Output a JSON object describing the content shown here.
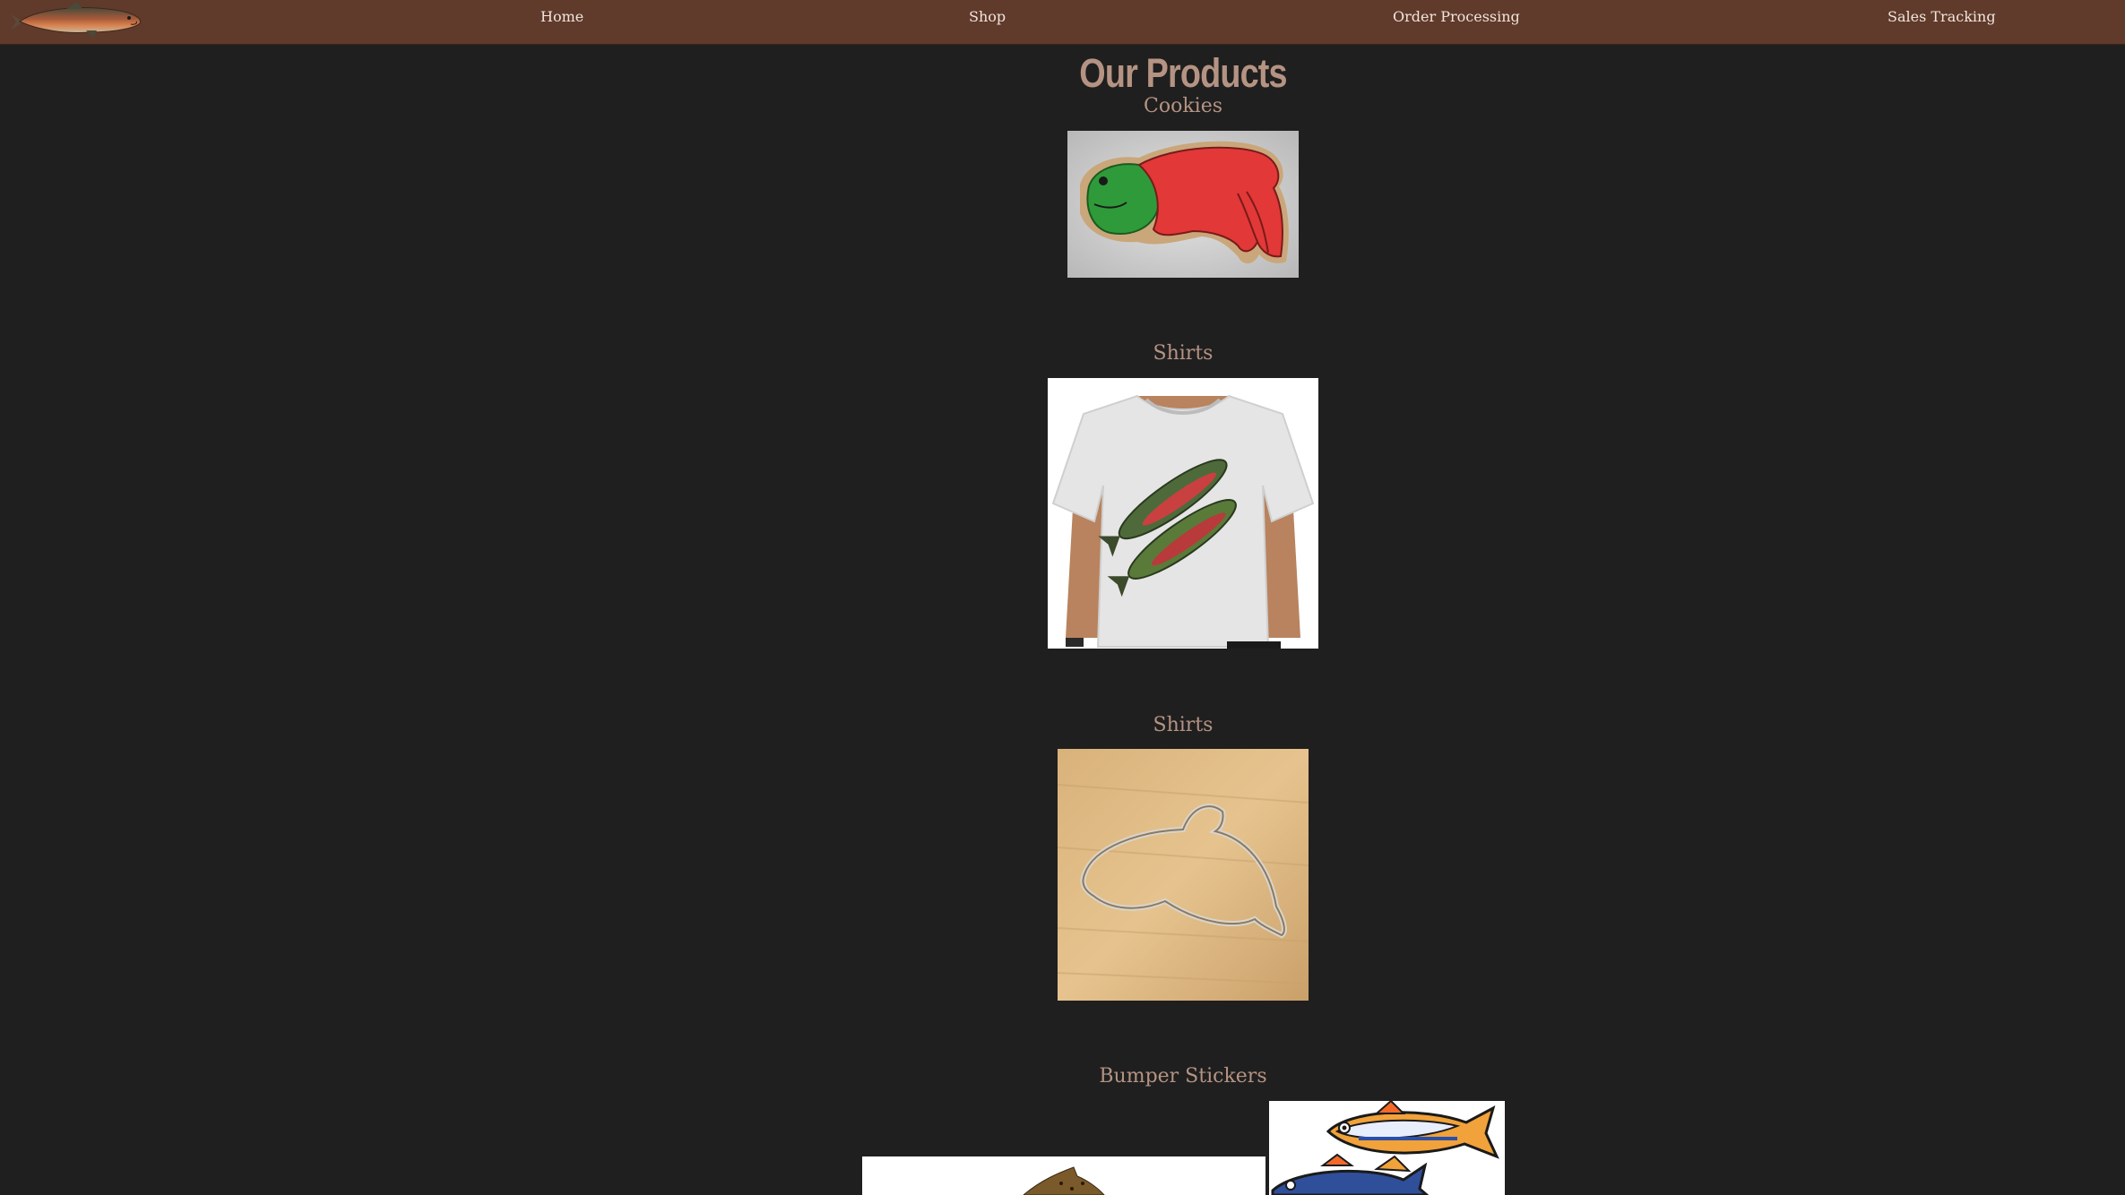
{
  "nav": {
    "logo_icon": "salmon-logo-icon",
    "links": [
      "Home",
      "Shop",
      "Order Processing",
      "Sales Tracking"
    ]
  },
  "main": {
    "title": "Our Products",
    "sections": [
      {
        "label": "Cookies",
        "image_icon": "salmon-cookie-image"
      },
      {
        "label": "Shirts",
        "image_icon": "salmon-shirt-image"
      },
      {
        "label": "Shirts",
        "image_icon": "salmon-cookie-cutter-image"
      },
      {
        "label": "Bumper Stickers",
        "image_icon": "fish-sticker-images"
      }
    ]
  },
  "colors": {
    "navbar": "#603a2b",
    "background": "#1f1f1f",
    "heading": "#b59383",
    "nav_text": "#f0e6dc"
  }
}
